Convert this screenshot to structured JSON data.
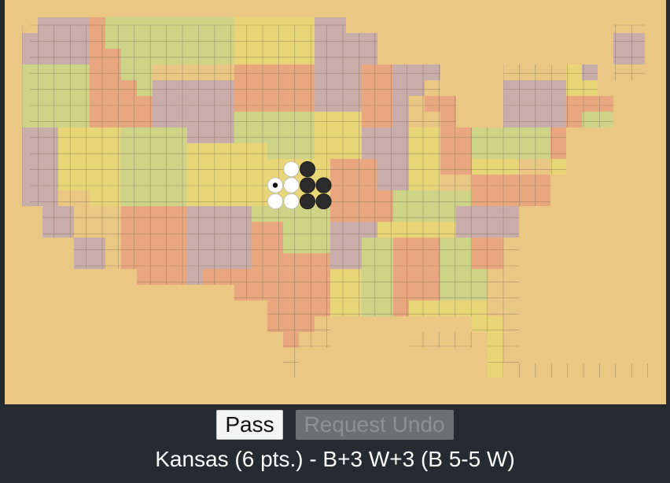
{
  "controls": {
    "pass_label": "Pass",
    "undo_label": "Request Undo",
    "undo_enabled": false
  },
  "status": {
    "text": "Kansas (6 pts.) - B+3 W+3 (B 5-5 W)"
  },
  "colors": {
    "board_bg": "#ebc784",
    "purple": "#c9adaa",
    "green": "#cdd487",
    "yellow": "#e8d578",
    "orange": "#e8a77e",
    "grid_line": "#6f6450"
  },
  "board": {
    "active_region": "Kansas",
    "last_move_marker": "white",
    "stones": [
      {
        "color": "white",
        "row": 10,
        "col": 16
      },
      {
        "color": "black",
        "row": 10,
        "col": 17
      },
      {
        "color": "white",
        "row": 11,
        "col": 15,
        "marked": true
      },
      {
        "color": "white",
        "row": 11,
        "col": 16
      },
      {
        "color": "black",
        "row": 11,
        "col": 17
      },
      {
        "color": "black",
        "row": 11,
        "col": 18
      },
      {
        "color": "white",
        "row": 12,
        "col": 15
      },
      {
        "color": "white",
        "row": 12,
        "col": 16
      },
      {
        "color": "black",
        "row": 12,
        "col": 17
      },
      {
        "color": "black",
        "row": 12,
        "col": 18
      }
    ]
  }
}
